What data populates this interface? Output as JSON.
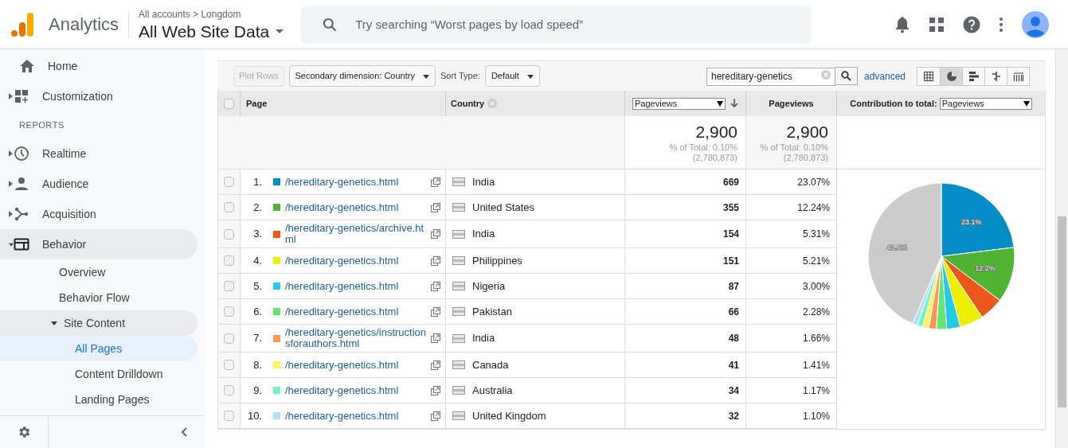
{
  "header": {
    "product": "Analytics",
    "breadcrumb": "All accounts > Longdom",
    "property": "All Web Site Data",
    "search": {
      "placeholder": "Try searching “Worst pages by load speed”"
    }
  },
  "sidebar": {
    "items": [
      {
        "label": "Home",
        "selected": false
      },
      {
        "label": "Customization",
        "expanded": false,
        "selected": false
      },
      {
        "kind": "heading",
        "label": "REPORTS"
      },
      {
        "label": "Realtime",
        "expanded": false,
        "selected": false
      },
      {
        "label": "Audience",
        "expanded": false,
        "selected": false
      },
      {
        "label": "Acquisition",
        "expanded": false,
        "selected": false
      },
      {
        "label": "Behavior",
        "expanded": true,
        "selected": false,
        "children": [
          {
            "label": "Overview",
            "selected": false
          },
          {
            "label": "Behavior Flow",
            "selected": false
          },
          {
            "label": "Site Content",
            "expanded": true,
            "selected": false,
            "children": [
              {
                "label": "All Pages",
                "selected": true
              },
              {
                "label": "Content Drilldown",
                "selected": false
              },
              {
                "label": "Landing Pages",
                "selected": false
              }
            ]
          }
        ]
      }
    ]
  },
  "toolbar": {
    "plot_rows": {
      "label": "Plot Rows",
      "disabled": true
    },
    "secondary_dimension": "Secondary dimension: Country",
    "sort_type_label": "Sort Type:",
    "sort_type": "Default",
    "filter": "hereditary-genetics",
    "advanced": "advanced",
    "views": [
      {
        "selected": false
      },
      {
        "selected": true
      },
      {
        "selected": false
      },
      {
        "selected": false
      },
      {
        "selected": false
      }
    ]
  },
  "table": {
    "select_all": {
      "checked": false
    },
    "columns": {
      "page": "Page",
      "country": "Country",
      "metric_select": "Pageviews",
      "metric": "Pageviews",
      "contribution_label": "Contribution to total:",
      "contribution_select": "Pageviews"
    },
    "totals": [
      {
        "value": "2,900",
        "percent": "% of Total: 0.10%",
        "total": "(2,780,873)"
      },
      {
        "value": "2,900",
        "percent": "% of Total: 0.10%",
        "total": "(2,780,873)"
      }
    ],
    "rows": [
      {
        "index": "1.",
        "color": "#058dc7",
        "page": "/hereditary-genetics.html",
        "country": "India",
        "pageviews": "669",
        "share": "23.07%",
        "checked": false
      },
      {
        "index": "2.",
        "color": "#50b432",
        "page": "/hereditary-genetics.html",
        "country": "United States",
        "pageviews": "355",
        "share": "12.24%",
        "checked": false
      },
      {
        "index": "3.",
        "color": "#ed561b",
        "page": "/hereditary-genetics/archive.html",
        "country": "India",
        "pageviews": "154",
        "share": "5.31%",
        "checked": false
      },
      {
        "index": "4.",
        "color": "#edef00",
        "page": "/hereditary-genetics.html",
        "country": "Philippines",
        "pageviews": "151",
        "share": "5.21%",
        "checked": false
      },
      {
        "index": "5.",
        "color": "#24cbe5",
        "page": "/hereditary-genetics.html",
        "country": "Nigeria",
        "pageviews": "87",
        "share": "3.00%",
        "checked": false
      },
      {
        "index": "6.",
        "color": "#64e572",
        "page": "/hereditary-genetics.html",
        "country": "Pakistan",
        "pageviews": "66",
        "share": "2.28%",
        "checked": false
      },
      {
        "index": "7.",
        "color": "#ff9655",
        "page": "/hereditary-genetics/instructionsforauthors.html",
        "country": "India",
        "pageviews": "48",
        "share": "1.66%",
        "checked": false
      },
      {
        "index": "8.",
        "color": "#fff263",
        "page": "/hereditary-genetics.html",
        "country": "Canada",
        "pageviews": "41",
        "share": "1.41%",
        "checked": false
      },
      {
        "index": "9.",
        "color": "#6af9c4",
        "page": "/hereditary-genetics.html",
        "country": "Australia",
        "pageviews": "34",
        "share": "1.17%",
        "checked": false
      },
      {
        "index": "10.",
        "color": "#b2deff",
        "page": "/hereditary-genetics.html",
        "country": "United Kingdom",
        "pageviews": "32",
        "share": "1.10%",
        "checked": false
      }
    ],
    "chart_data": {
      "type": "pie",
      "values": [
        23.07,
        12.24,
        5.31,
        5.21,
        3.0,
        2.28,
        1.66,
        1.41,
        1.17,
        1.1,
        43.55
      ],
      "value_labels": [
        "23.1%",
        "12.2%",
        null,
        null,
        null,
        null,
        null,
        null,
        null,
        null,
        "43.6%"
      ]
    }
  }
}
